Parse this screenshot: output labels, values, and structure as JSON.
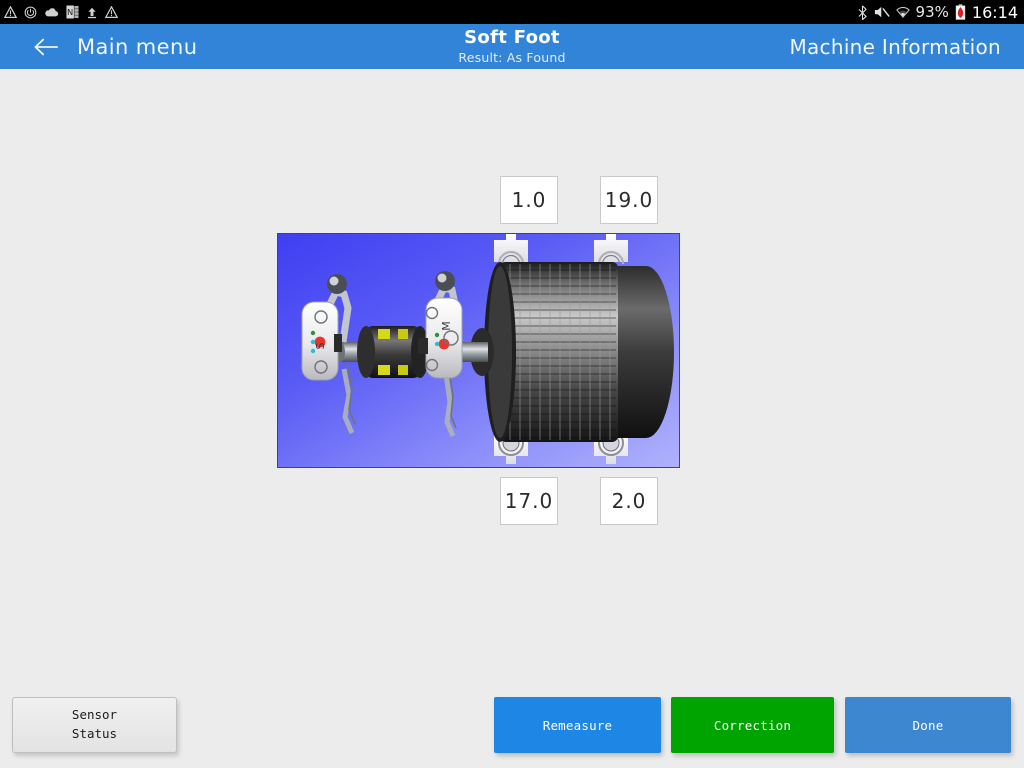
{
  "statusbar": {
    "left_icons": [
      {
        "name": "warning-triangle-icon",
        "glyph": "⚠"
      },
      {
        "name": "power-circle-icon",
        "glyph": "◎"
      },
      {
        "name": "cloud-icon",
        "glyph": "☁"
      },
      {
        "name": "onenote-app-icon",
        "glyph": "N"
      },
      {
        "name": "upload-arrow-icon",
        "glyph": "↑"
      },
      {
        "name": "warning-triangle-icon-2",
        "glyph": "⚠"
      }
    ],
    "right_icons": [
      {
        "name": "bluetooth-icon",
        "glyph": "ᛗ"
      },
      {
        "name": "mute-icon",
        "glyph": "╳"
      },
      {
        "name": "wifi-icon",
        "glyph": "▲"
      }
    ],
    "battery_percent": "93%",
    "battery_icon_name": "battery-low-icon",
    "clock": "16:14"
  },
  "header": {
    "back_icon_name": "back-arrow-icon",
    "menu_label": "Main menu",
    "title": "Soft Foot",
    "subtitle": "Result: As Found",
    "machine_info_label": "Machine Information",
    "accent_color": "#3184d7"
  },
  "softfoot": {
    "values": {
      "top_left": "1.0",
      "top_right": "19.0",
      "bottom_left": "17.0",
      "bottom_right": "2.0"
    },
    "illustration": {
      "name": "machine-alignment-illustration",
      "description": "Electric motor with shaft coupling and two laser alignment sensors mounted on the shaft, shown on a blue gradient background with four highlighted machine feet",
      "sensor_labels": [
        "S",
        "M"
      ],
      "background_color": "#5a5cf5"
    }
  },
  "footer": {
    "sensor_status": {
      "line1": "Sensor",
      "line2": "Status"
    },
    "buttons": [
      {
        "name": "remeasure-button",
        "label": "Remeasure",
        "color": "#1e87e5"
      },
      {
        "name": "correction-button",
        "label": "Correction",
        "color": "#00a400"
      },
      {
        "name": "done-button",
        "label": "Done",
        "color": "#3c87d0"
      }
    ]
  }
}
